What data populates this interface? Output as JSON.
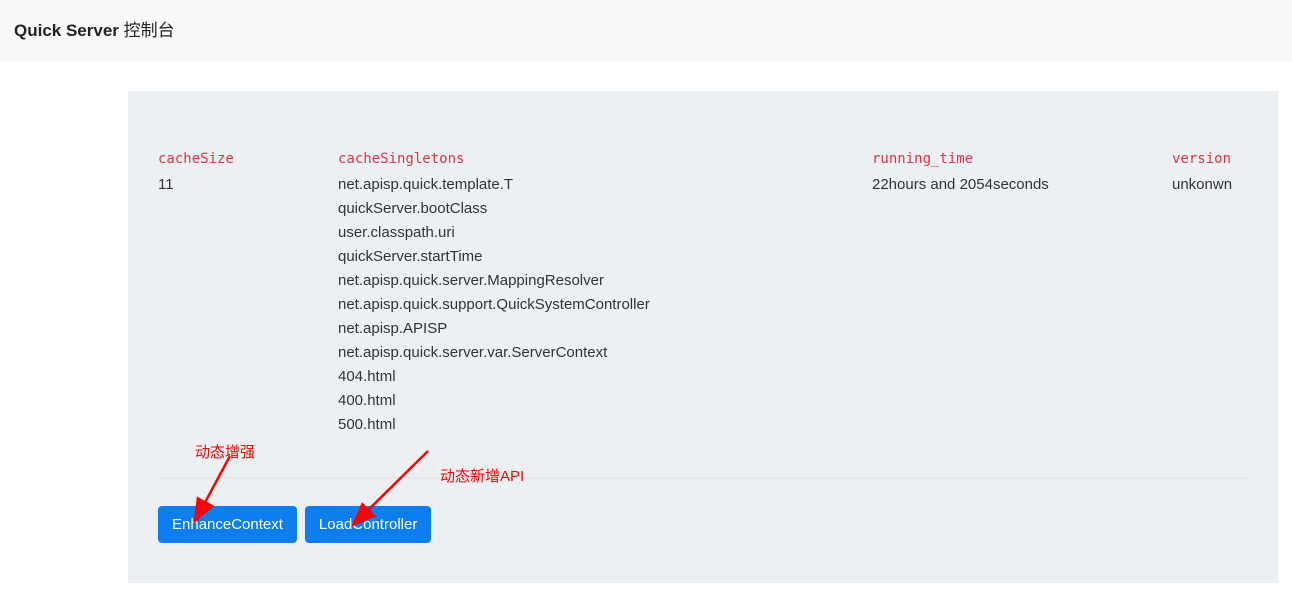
{
  "header": {
    "title_bold": "Quick Server",
    "title_rest": " 控制台"
  },
  "metrics": {
    "cacheSize": {
      "label": "cacheSize",
      "value": "11"
    },
    "cacheSingletons": {
      "label": "cacheSingletons",
      "items": [
        "net.apisp.quick.template.T",
        "quickServer.bootClass",
        "user.classpath.uri",
        "quickServer.startTime",
        "net.apisp.quick.server.MappingResolver",
        "net.apisp.quick.support.QuickSystemController",
        "net.apisp.APISP",
        "net.apisp.quick.server.var.ServerContext",
        "404.html",
        "400.html",
        "500.html"
      ]
    },
    "runningTime": {
      "label": "running_time",
      "value": "22hours and 2054seconds"
    },
    "version": {
      "label": "version",
      "value": "unkonwn"
    }
  },
  "buttons": {
    "enhanceContext": "EnhanceContext",
    "loadController": "LoadController"
  },
  "annotations": {
    "enhance": "动态增强",
    "loadApi": "动态新增API"
  }
}
